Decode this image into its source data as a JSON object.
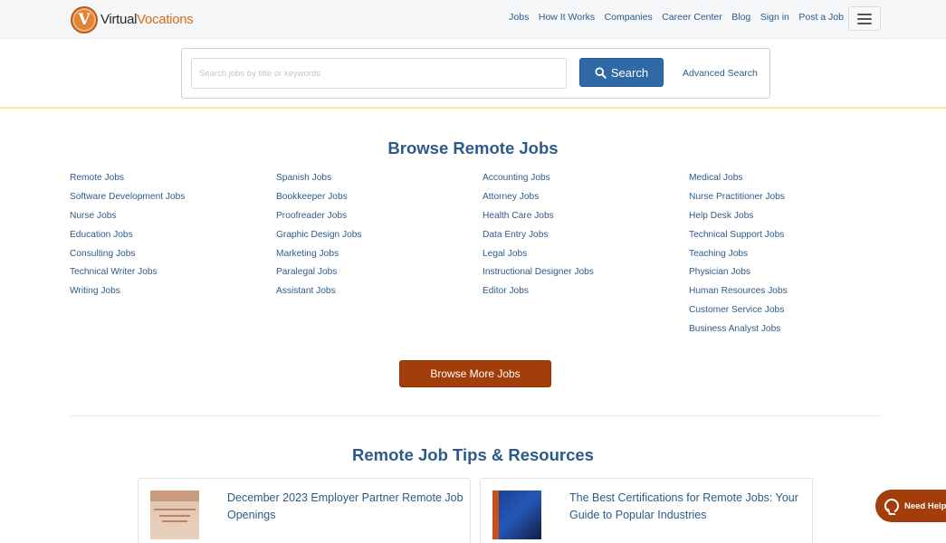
{
  "header": {
    "logo": {
      "virtual": "Virtual",
      "vocations": "Vocations",
      "mark": "V"
    },
    "nav": [
      "Jobs",
      "How It Works",
      "Companies",
      "Career Center",
      "Blog",
      "Sign in",
      "Post a Job"
    ],
    "menu_icon": "hamburger-icon"
  },
  "search": {
    "placeholder": "Search jobs by title or keywords",
    "button_label": "Search",
    "advanced_label": "Advanced Search"
  },
  "browse": {
    "title": "Browse Remote Jobs",
    "columns": [
      [
        "Remote Jobs",
        "Software Development Jobs",
        "Nurse Jobs",
        "Education Jobs",
        "Consulting Jobs",
        "Technical Writer Jobs",
        "Writing Jobs"
      ],
      [
        "Spanish Jobs",
        "Bookkeeper Jobs",
        "Proofreader Jobs",
        "Graphic Design Jobs",
        "Marketing Jobs",
        "Paralegal Jobs",
        "Assistant Jobs"
      ],
      [
        "Accounting Jobs",
        "Attorney Jobs",
        "Health Care Jobs",
        "Data Entry Jobs",
        "Legal Jobs",
        "Instructional Designer Jobs",
        "Editor Jobs"
      ],
      [
        "Medical Jobs",
        "Nurse Practitioner Jobs",
        "Help Desk Jobs",
        "Technical Support Jobs",
        "Teaching Jobs",
        "Physician Jobs",
        "Human Resources Jobs",
        "Customer Service Jobs",
        "Business Analyst Jobs"
      ]
    ],
    "more_label": "Browse More Jobs"
  },
  "tips": {
    "title": "Remote Job Tips & Resources",
    "cards": [
      {
        "title": "December 2023 Employer Partner Remote Job Openings"
      },
      {
        "title": "The Best Certifications for Remote Jobs: Your Guide to Popular Industries"
      }
    ]
  },
  "help": {
    "label": "Need Help"
  },
  "colors": {
    "accent": "#2f6aa7",
    "brand_orange": "#a33e0a",
    "link": "#2c5b8a"
  }
}
